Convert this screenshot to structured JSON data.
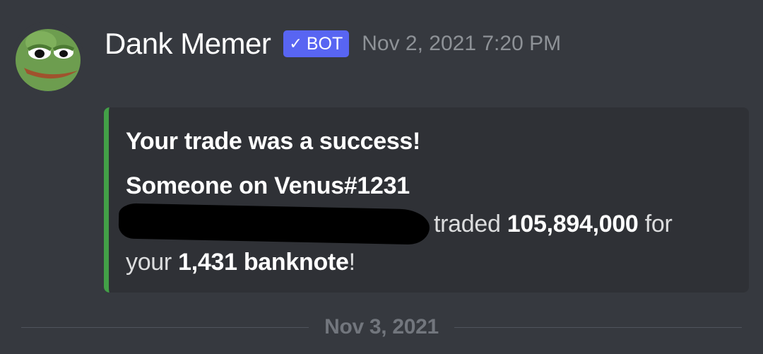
{
  "message": {
    "username": "Dank Memer",
    "bot_tag": {
      "check": "✓",
      "label": "BOT"
    },
    "timestamp": "Nov 2, 2021 7:20 PM",
    "avatar_icon": "pepe-frog-avatar"
  },
  "embed": {
    "accent_color": "#43a047",
    "title": "Your trade was a success!",
    "desc_line1": "Someone on Venus#1231",
    "traded_text": "traded",
    "amount": "105,894,000",
    "for_text": "for",
    "your_text": "your",
    "banknote_count": "1,431 banknote",
    "exclaim": "!"
  },
  "divider": {
    "date": "Nov 3, 2021"
  },
  "colors": {
    "background": "#36393f",
    "embed_background": "#2f3136",
    "bot_tag": "#5865f2",
    "timestamp": "#8e9297"
  }
}
